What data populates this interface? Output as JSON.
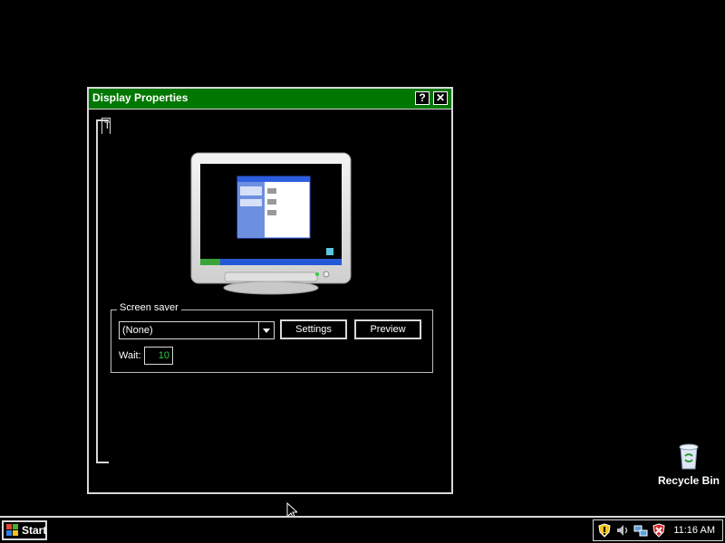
{
  "window": {
    "title": "Display Properties",
    "help_label": "?",
    "close_label": "✕",
    "tab_stub_label": "T"
  },
  "screensaver": {
    "group_label": "Screen saver",
    "selected": "(None)",
    "settings_label": "Settings",
    "preview_label": "Preview",
    "wait_label": "Wait:",
    "wait_value": "10"
  },
  "desktop": {
    "recycle_bin_label": "Recycle Bin"
  },
  "taskbar": {
    "start_label": "Start",
    "clock": "11:16 AM",
    "tray_icons": [
      "security-shield-icon",
      "speaker-icon",
      "network-icon",
      "security-alert-icon"
    ]
  },
  "colors": {
    "title_bar": "#007700",
    "window_border": "#d8d8d8",
    "wait_value_text": "#2ecc40",
    "background": "#000000"
  }
}
